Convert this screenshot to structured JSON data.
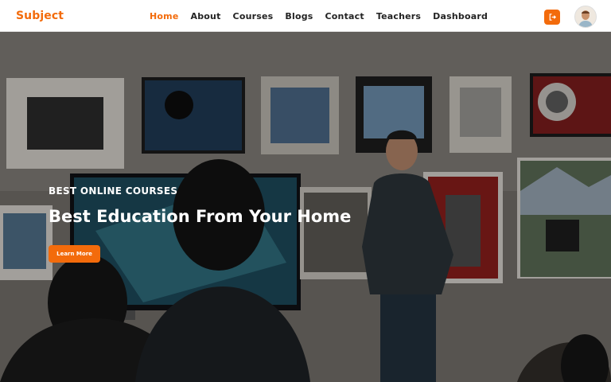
{
  "brand": {
    "name": "Subject",
    "color": "#f36b0b"
  },
  "nav": {
    "items": [
      {
        "label": "Home",
        "active": true
      },
      {
        "label": "About",
        "active": false
      },
      {
        "label": "Courses",
        "active": false
      },
      {
        "label": "Blogs",
        "active": false
      },
      {
        "label": "Contact",
        "active": false
      },
      {
        "label": "Teachers",
        "active": false
      },
      {
        "label": "Dashboard",
        "active": false
      }
    ],
    "logout_icon": "logout-icon",
    "avatar_icon": "user-avatar"
  },
  "hero": {
    "kicker": "BEST ONLINE COURSES",
    "title": "Best Education From Your Home",
    "cta_label": "Learn More"
  },
  "colors": {
    "accent": "#f36b0b",
    "nav_text": "#232323"
  }
}
